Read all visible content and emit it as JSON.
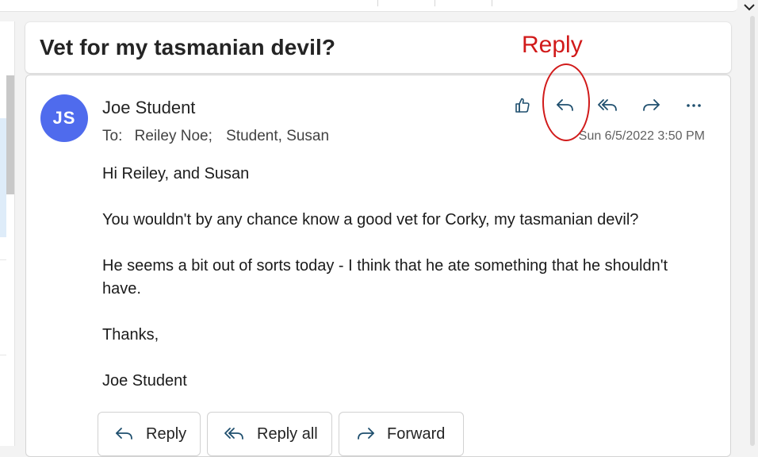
{
  "subject": "Vet for my tasmanian devil?",
  "message": {
    "avatar_initials": "JS",
    "sender": "Joe Student",
    "to_label": "To:",
    "recipients": [
      "Reiley Noe;",
      "Student, Susan"
    ],
    "timestamp": "Sun 6/5/2022 3:50 PM",
    "body": [
      "Hi Reiley, and Susan",
      "You wouldn't by any chance know a good vet for Corky, my tasmanian devil?",
      "He seems a bit out of sorts today - I think that he ate something that he shouldn't have.",
      "Thanks,",
      "Joe Student"
    ]
  },
  "toolbar_icons": [
    "like-icon",
    "reply-icon",
    "reply-all-icon",
    "forward-icon",
    "more-icon"
  ],
  "buttons": {
    "reply": "Reply",
    "reply_all": "Reply all",
    "forward": "Forward"
  },
  "annotation": {
    "label": "Reply",
    "color": "#d11a1a"
  },
  "colors": {
    "avatar": "#4f6bed",
    "icon": "#1f4f6e"
  }
}
